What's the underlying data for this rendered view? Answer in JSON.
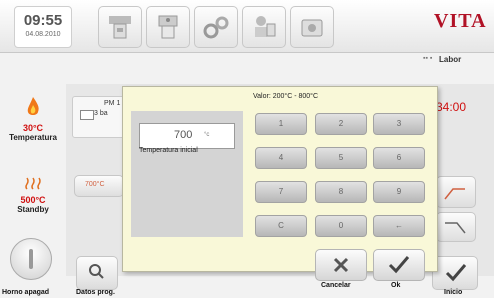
{
  "header": {
    "clock_time": "09:55",
    "clock_date": "04.08.2010",
    "brand": "VITA",
    "brand_color": "#b11226",
    "labor_label": "Labor",
    "tabs": [
      {
        "icon": "firing-chamber-icon"
      },
      {
        "icon": "furnace-head-icon"
      },
      {
        "icon": "settings-gears-icon"
      },
      {
        "icon": "user-service-icon"
      },
      {
        "icon": "camera-icon"
      }
    ]
  },
  "left_panel": {
    "temperature_value": "30°C",
    "temperature_label": "Temperatura",
    "standby_value": "500°C",
    "standby_label": "Standby",
    "power_label": "Horno apagad"
  },
  "program": {
    "name": "PM 1",
    "sub": "3 ba",
    "time": "34:00",
    "temp_button": "700°C"
  },
  "bottom": {
    "datos_label": "Datos prog.",
    "inicio_label": "Inicio"
  },
  "dialog": {
    "range_label": "Valor: 200°C - 800°C",
    "field_value": "700",
    "field_unit": "°c",
    "field_label": "Temperatura inicial",
    "keys": [
      "1",
      "2",
      "3",
      "4",
      "5",
      "6",
      "7",
      "8",
      "9",
      "C",
      "0",
      "←"
    ],
    "cancel_label": "Cancelar",
    "ok_label": "Ok"
  },
  "colors": {
    "highlight_red": "#d01010",
    "dialog_bg": "#f9f8d8"
  }
}
